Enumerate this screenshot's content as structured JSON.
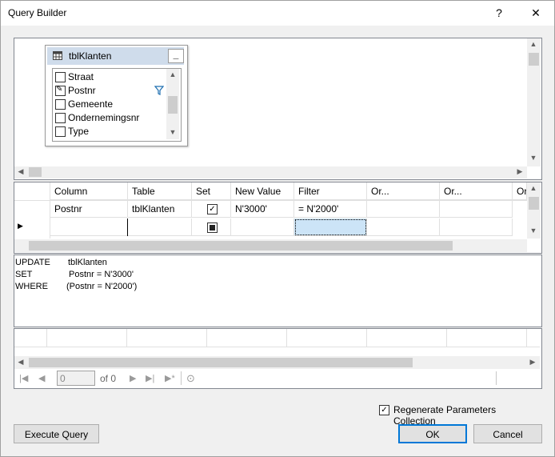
{
  "window": {
    "title": "Query Builder",
    "help_glyph": "?",
    "close_glyph": "✕"
  },
  "diagram": {
    "table_name": "tblKlanten",
    "minimize_glyph": "_",
    "columns": [
      {
        "name": "Straat",
        "checked": false,
        "pencil": false,
        "filter": false
      },
      {
        "name": "Postnr",
        "checked": true,
        "pencil": true,
        "filter": true
      },
      {
        "name": "Gemeente",
        "checked": false,
        "pencil": false,
        "filter": false
      },
      {
        "name": "Ondernemingsnr",
        "checked": false,
        "pencil": false,
        "filter": false
      },
      {
        "name": "Type",
        "checked": false,
        "pencil": false,
        "filter": false
      }
    ]
  },
  "grid": {
    "headers": [
      "Column",
      "Table",
      "Set",
      "New Value",
      "Filter",
      "Or...",
      "Or...",
      "Or..."
    ],
    "rows": [
      {
        "column": "Postnr",
        "table": "tblKlanten",
        "set": true,
        "new_value": "N'3000'",
        "filter": "= N'2000'"
      }
    ]
  },
  "sql": {
    "line1_kw": "UPDATE",
    "line1_val": "tblKlanten",
    "line2_kw": "SET",
    "line2_val": "Postnr = N'3000'",
    "line3_kw": "WHERE",
    "line3_val": "(Postnr = N'2000')"
  },
  "navigator": {
    "position": "0",
    "of_label": "of 0"
  },
  "regenerate": {
    "label": "Regenerate Parameters Collection",
    "checked": true
  },
  "buttons": {
    "execute": "Execute Query",
    "ok": "OK",
    "cancel": "Cancel"
  }
}
